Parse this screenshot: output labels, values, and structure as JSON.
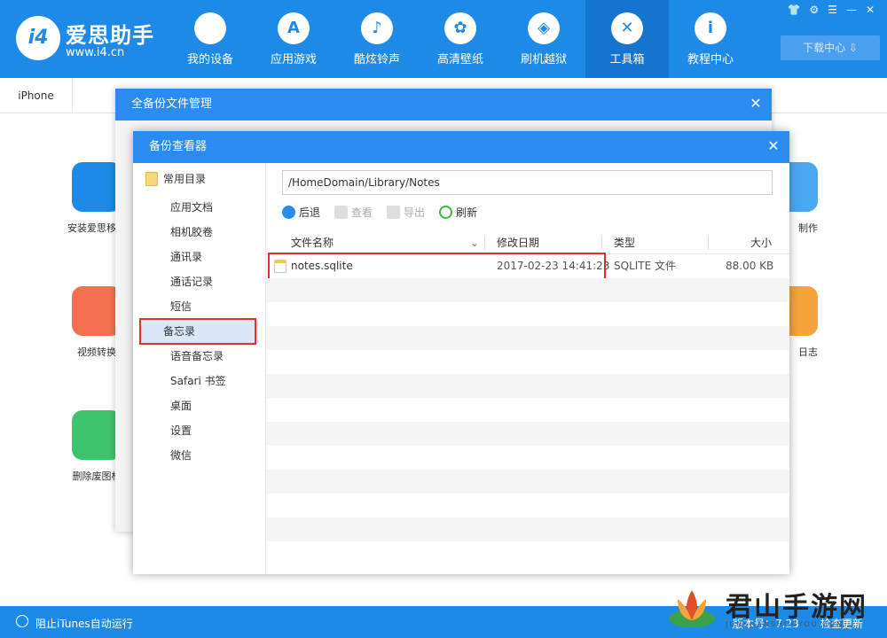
{
  "app": {
    "brand_name": "爱思助手",
    "brand_url": "www.i4.cn",
    "logo_text": "i4"
  },
  "nav": [
    {
      "label": "我的设备",
      "icon": "apple-icon",
      "glyph": ""
    },
    {
      "label": "应用游戏",
      "icon": "appstore-icon",
      "glyph": "A"
    },
    {
      "label": "酷炫铃声",
      "icon": "bell-icon",
      "glyph": "♪"
    },
    {
      "label": "高清壁纸",
      "icon": "flower-icon",
      "glyph": "✿"
    },
    {
      "label": "刷机越狱",
      "icon": "dropbox-icon",
      "glyph": "◈"
    },
    {
      "label": "工具箱",
      "icon": "tools-icon",
      "glyph": "✕"
    },
    {
      "label": "教程中心",
      "icon": "info-icon",
      "glyph": "i"
    }
  ],
  "download_label": "下载中心 ⇩",
  "device_tab": "iPhone",
  "bg_tools": [
    {
      "label": "安装爱思移动",
      "color": "#1d8ae8"
    },
    {
      "label": "视频转换",
      "color": "#f5704f"
    },
    {
      "label": "删除废图标",
      "color": "#3ec46d"
    },
    {
      "label": "制作",
      "color": "#49a8f0"
    },
    {
      "label": "日志",
      "color": "#f5a33a"
    }
  ],
  "outer_dialog": {
    "title": "全备份文件管理"
  },
  "inner_dialog": {
    "title": "备份查看器"
  },
  "sidebar": {
    "header": "常用目录",
    "items": [
      "应用文档",
      "相机胶卷",
      "通讯录",
      "通话记录",
      "短信",
      "备忘录",
      "语音备忘录",
      "Safari 书签",
      "桌面",
      "设置",
      "微信"
    ],
    "selected_index": 5
  },
  "path": "/HomeDomain/Library/Notes",
  "toolbar": {
    "back": "后退",
    "view": "查看",
    "export": "导出",
    "refresh": "刷新"
  },
  "columns": [
    "文件名称",
    "修改日期",
    "类型",
    "大小"
  ],
  "files": [
    {
      "name": "notes.sqlite",
      "modified": "2017-02-23 14:41:23",
      "type": "SQLITE 文件",
      "size": "88.00 KB"
    }
  ],
  "status": {
    "itunes_block": "阻止iTunes自动运行",
    "version": "版本号：7.23",
    "check_update": "检查更新"
  },
  "watermark": {
    "text": "君山手游网",
    "sub": "JUNSHANSHOUYOU.COM"
  },
  "colors": {
    "primary": "#1d8ae8",
    "dialog_title": "#2a8cf0",
    "highlight": "#e0302f"
  }
}
